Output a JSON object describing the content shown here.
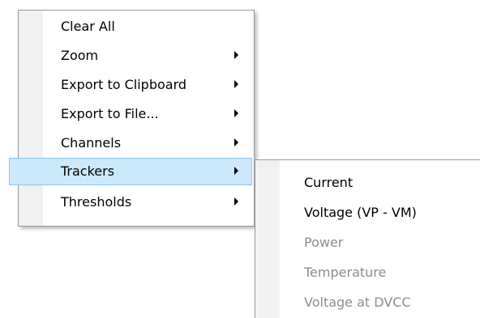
{
  "context_menu": {
    "items": [
      {
        "label": "Clear All",
        "has_submenu": false,
        "highlighted": false
      },
      {
        "label": "Zoom",
        "has_submenu": true,
        "highlighted": false
      },
      {
        "label": "Export to Clipboard",
        "has_submenu": true,
        "highlighted": false
      },
      {
        "label": "Export to File...",
        "has_submenu": true,
        "highlighted": false
      },
      {
        "label": "Channels",
        "has_submenu": true,
        "highlighted": false
      },
      {
        "label": "Trackers",
        "has_submenu": true,
        "highlighted": true
      },
      {
        "label": "Thresholds",
        "has_submenu": true,
        "highlighted": false
      }
    ]
  },
  "trackers_submenu": {
    "items": [
      {
        "label": "Current",
        "enabled": true
      },
      {
        "label": "Voltage (VP - VM)",
        "enabled": true
      },
      {
        "label": "Power",
        "enabled": false
      },
      {
        "label": "Temperature",
        "enabled": false
      },
      {
        "label": "Voltage at DVCC",
        "enabled": false
      }
    ]
  },
  "colors": {
    "highlight_fill": "#cce8fb",
    "highlight_border": "#8cc4ee",
    "disabled_text": "#8c8c8c",
    "gutter": "#f1f1f1"
  }
}
